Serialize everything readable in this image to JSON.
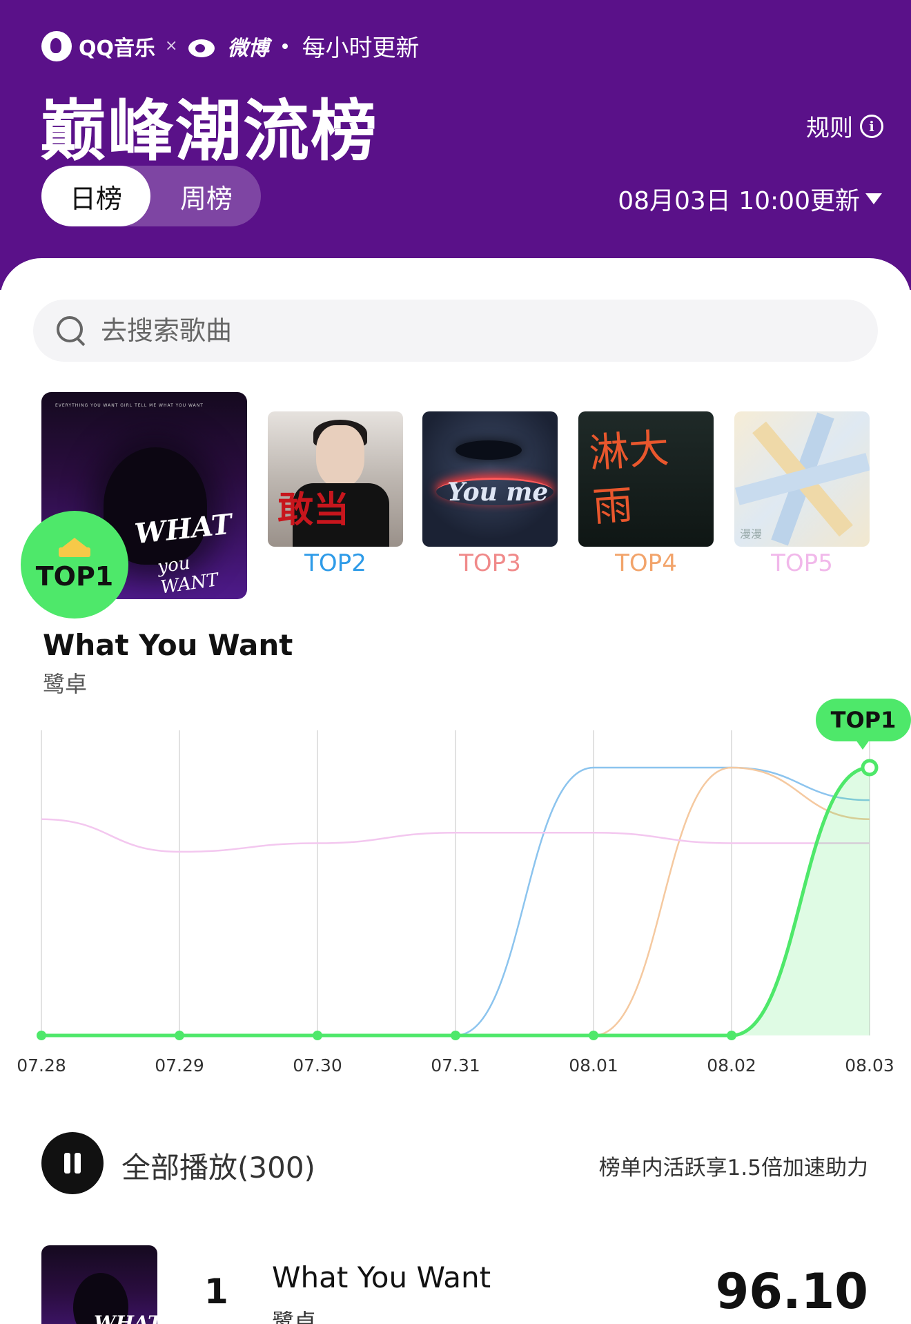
{
  "header": {
    "brand_qq": "QQ音乐",
    "brand_x": "×",
    "brand_weibo": "微博",
    "brand_update": "每小时更新",
    "title": "巅峰潮流榜",
    "rules_label": "规则",
    "tabs": [
      {
        "label": "日榜",
        "active": true
      },
      {
        "label": "周榜",
        "active": false
      }
    ],
    "update_time": "08月03日 10:00更新",
    "background_color": "#5a1189"
  },
  "search": {
    "placeholder": "去搜索歌曲"
  },
  "top_covers": {
    "top1": {
      "badge": "TOP1",
      "cover_text": "WHAT you WANT"
    },
    "others": [
      {
        "label": "TOP2",
        "color": "#2e9be8",
        "cover_text": "敢当"
      },
      {
        "label": "TOP3",
        "color": "#f08a8a",
        "cover_text": "You me"
      },
      {
        "label": "TOP4",
        "color": "#f2a46b",
        "cover_text": "淋大雨"
      },
      {
        "label": "TOP5",
        "color": "#f1b8ea",
        "cover_text": "漫漫"
      }
    ]
  },
  "featured_song": {
    "title": "What You Want",
    "artist": "鹭卓"
  },
  "chart_data": {
    "type": "line",
    "x": [
      "07.28",
      "07.29",
      "07.30",
      "07.31",
      "08.01",
      "08.02",
      "08.03"
    ],
    "y_axis": "rank, top at the top",
    "series": [
      {
        "color": "#4ee86a",
        "values": [
          300,
          300,
          300,
          300,
          300,
          300,
          1
        ],
        "highlight": true
      },
      {
        "color": "#8cc4ee",
        "values": [
          300,
          300,
          300,
          300,
          1,
          1,
          2
        ]
      },
      {
        "color": "#f5c9a0",
        "values": [
          300,
          300,
          300,
          300,
          300,
          1,
          3
        ]
      },
      {
        "color": "#f3c7ef",
        "values": [
          3,
          6,
          5,
          4,
          4,
          5,
          5
        ]
      }
    ],
    "tooltip": "TOP1",
    "grid": true
  },
  "play_row": {
    "play_all": "全部播放(300)",
    "boost_text": "榜单内活跃享1.5倍加速助力"
  },
  "list": [
    {
      "rank": "1",
      "title": "What You Want",
      "artist": "鹭卓",
      "score": "96.10",
      "cover_text": "WHAT"
    }
  ]
}
